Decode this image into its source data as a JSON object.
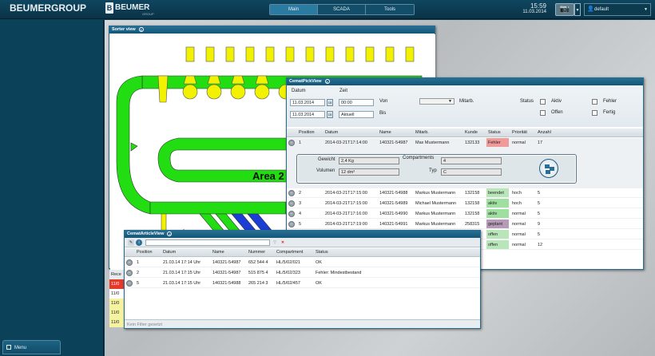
{
  "header": {
    "brand": "BEUMERGROUP",
    "brand2_box": "B",
    "brand2": "BEUMER",
    "brand2_sub": "GROUP",
    "tabs": [
      "Main",
      "SCADA",
      "Tools"
    ],
    "time": "15:59",
    "date": "11.03.2014",
    "user": "default",
    "camera_icon": "camera-icon",
    "user_icon": "user-icon"
  },
  "leftpanel": {
    "menu_label": "Menu"
  },
  "sorter": {
    "title": "Sorter view",
    "area_label": "Area 2"
  },
  "pick": {
    "title": "CematPickView",
    "labels": {
      "datum": "Datum",
      "zeit": "Zeit",
      "von": "Von",
      "bis": "Bis",
      "mitarb": "Mitarb.",
      "status": "Status",
      "aktiv": "Aktiv",
      "offen": "Offen",
      "fehler": "Fehler",
      "fertig": "Fertig"
    },
    "values": {
      "date_from": "11.03.2014",
      "time_from": "00:00",
      "date_to": "11.03.2014",
      "time_to": "Aktuell",
      "cal": "15"
    },
    "columns": [
      "Position",
      "Datum",
      "Name",
      "Mitarb.",
      "Kunde",
      "Status",
      "Priorität",
      "Anzahl"
    ],
    "rows": [
      {
        "pos": "1",
        "datum": "2014-03-21T17:14:00",
        "name": "140321-54987",
        "mitarb": "Max Mustermann",
        "kunde": "132133",
        "status": "Fehler",
        "prio": "normal",
        "anzahl": "17",
        "color": "#f19a9a"
      },
      {
        "pos": "2",
        "datum": "2014-03-21T17:15:00",
        "name": "140321-54988",
        "mitarb": "Markus Mustermann",
        "kunde": "132158",
        "status": "beendet",
        "prio": "hoch",
        "anzahl": "5",
        "color": "#b8e6b8"
      },
      {
        "pos": "3",
        "datum": "2014-03-21T17:15:00",
        "name": "140321-54989",
        "mitarb": "Michael Mustermann",
        "kunde": "132158",
        "status": "aktiv",
        "prio": "hoch",
        "anzahl": "5",
        "color": "#9fdf9f"
      },
      {
        "pos": "4",
        "datum": "2014-03-21T17:16:00",
        "name": "140321-54990",
        "mitarb": "Markus Mustermann",
        "kunde": "132158",
        "status": "aktiv",
        "prio": "normal",
        "anzahl": "5",
        "color": "#9fdf9f"
      },
      {
        "pos": "5",
        "datum": "2014-03-21T17:19:00",
        "name": "140321-54991",
        "mitarb": "Markus Mustermann",
        "kunde": "258315",
        "status": "geplant",
        "prio": "normal",
        "anzahl": "9",
        "color": "#b79ab7"
      },
      {
        "pos": "",
        "datum": "",
        "name": "",
        "mitarb": "",
        "kunde": "",
        "status": "offen",
        "prio": "normal",
        "anzahl": "5",
        "color": "#b8e6b8"
      },
      {
        "pos": "",
        "datum": "",
        "name": "",
        "mitarb": "",
        "kunde": "",
        "status": "offen",
        "prio": "normal",
        "anzahl": "12",
        "color": "#b8e6b8"
      }
    ],
    "detail": {
      "gewicht_label": "Gewicht",
      "gewicht": "2,4 Kg",
      "volumen_label": "Volumen",
      "volumen": "12 dm³",
      "compartments_label": "Compartments",
      "compartments": "4",
      "typ_label": "Typ",
      "typ": "C"
    }
  },
  "article": {
    "title": "CematArticleView",
    "columns": [
      "Position",
      "Datum",
      "Name",
      "Nummer",
      "Compartment",
      "Status"
    ],
    "rows": [
      {
        "pos": "1",
        "datum": "21.03.14 17:14 Uhr",
        "name": "140321-54987",
        "nummer": "652 544 4",
        "comp": "HL/5/02/021",
        "status": "OK"
      },
      {
        "pos": "2",
        "datum": "21.03.14 17:15 Uhr",
        "name": "140321-54987",
        "nummer": "515 875 4",
        "comp": "HL/5/02/323",
        "status": "Fehler: Mindestbestand"
      },
      {
        "pos": "5",
        "datum": "21.03.14 17:15 Uhr",
        "name": "140321-54988",
        "nummer": "265 214 3",
        "comp": "HL/5/02/457",
        "status": "OK"
      }
    ],
    "footer": "Kein Filter gesetzt"
  },
  "receive": {
    "header": "Rece",
    "items": [
      "11/0",
      "11/0",
      "11/0",
      "11/0",
      "11/0"
    ]
  }
}
